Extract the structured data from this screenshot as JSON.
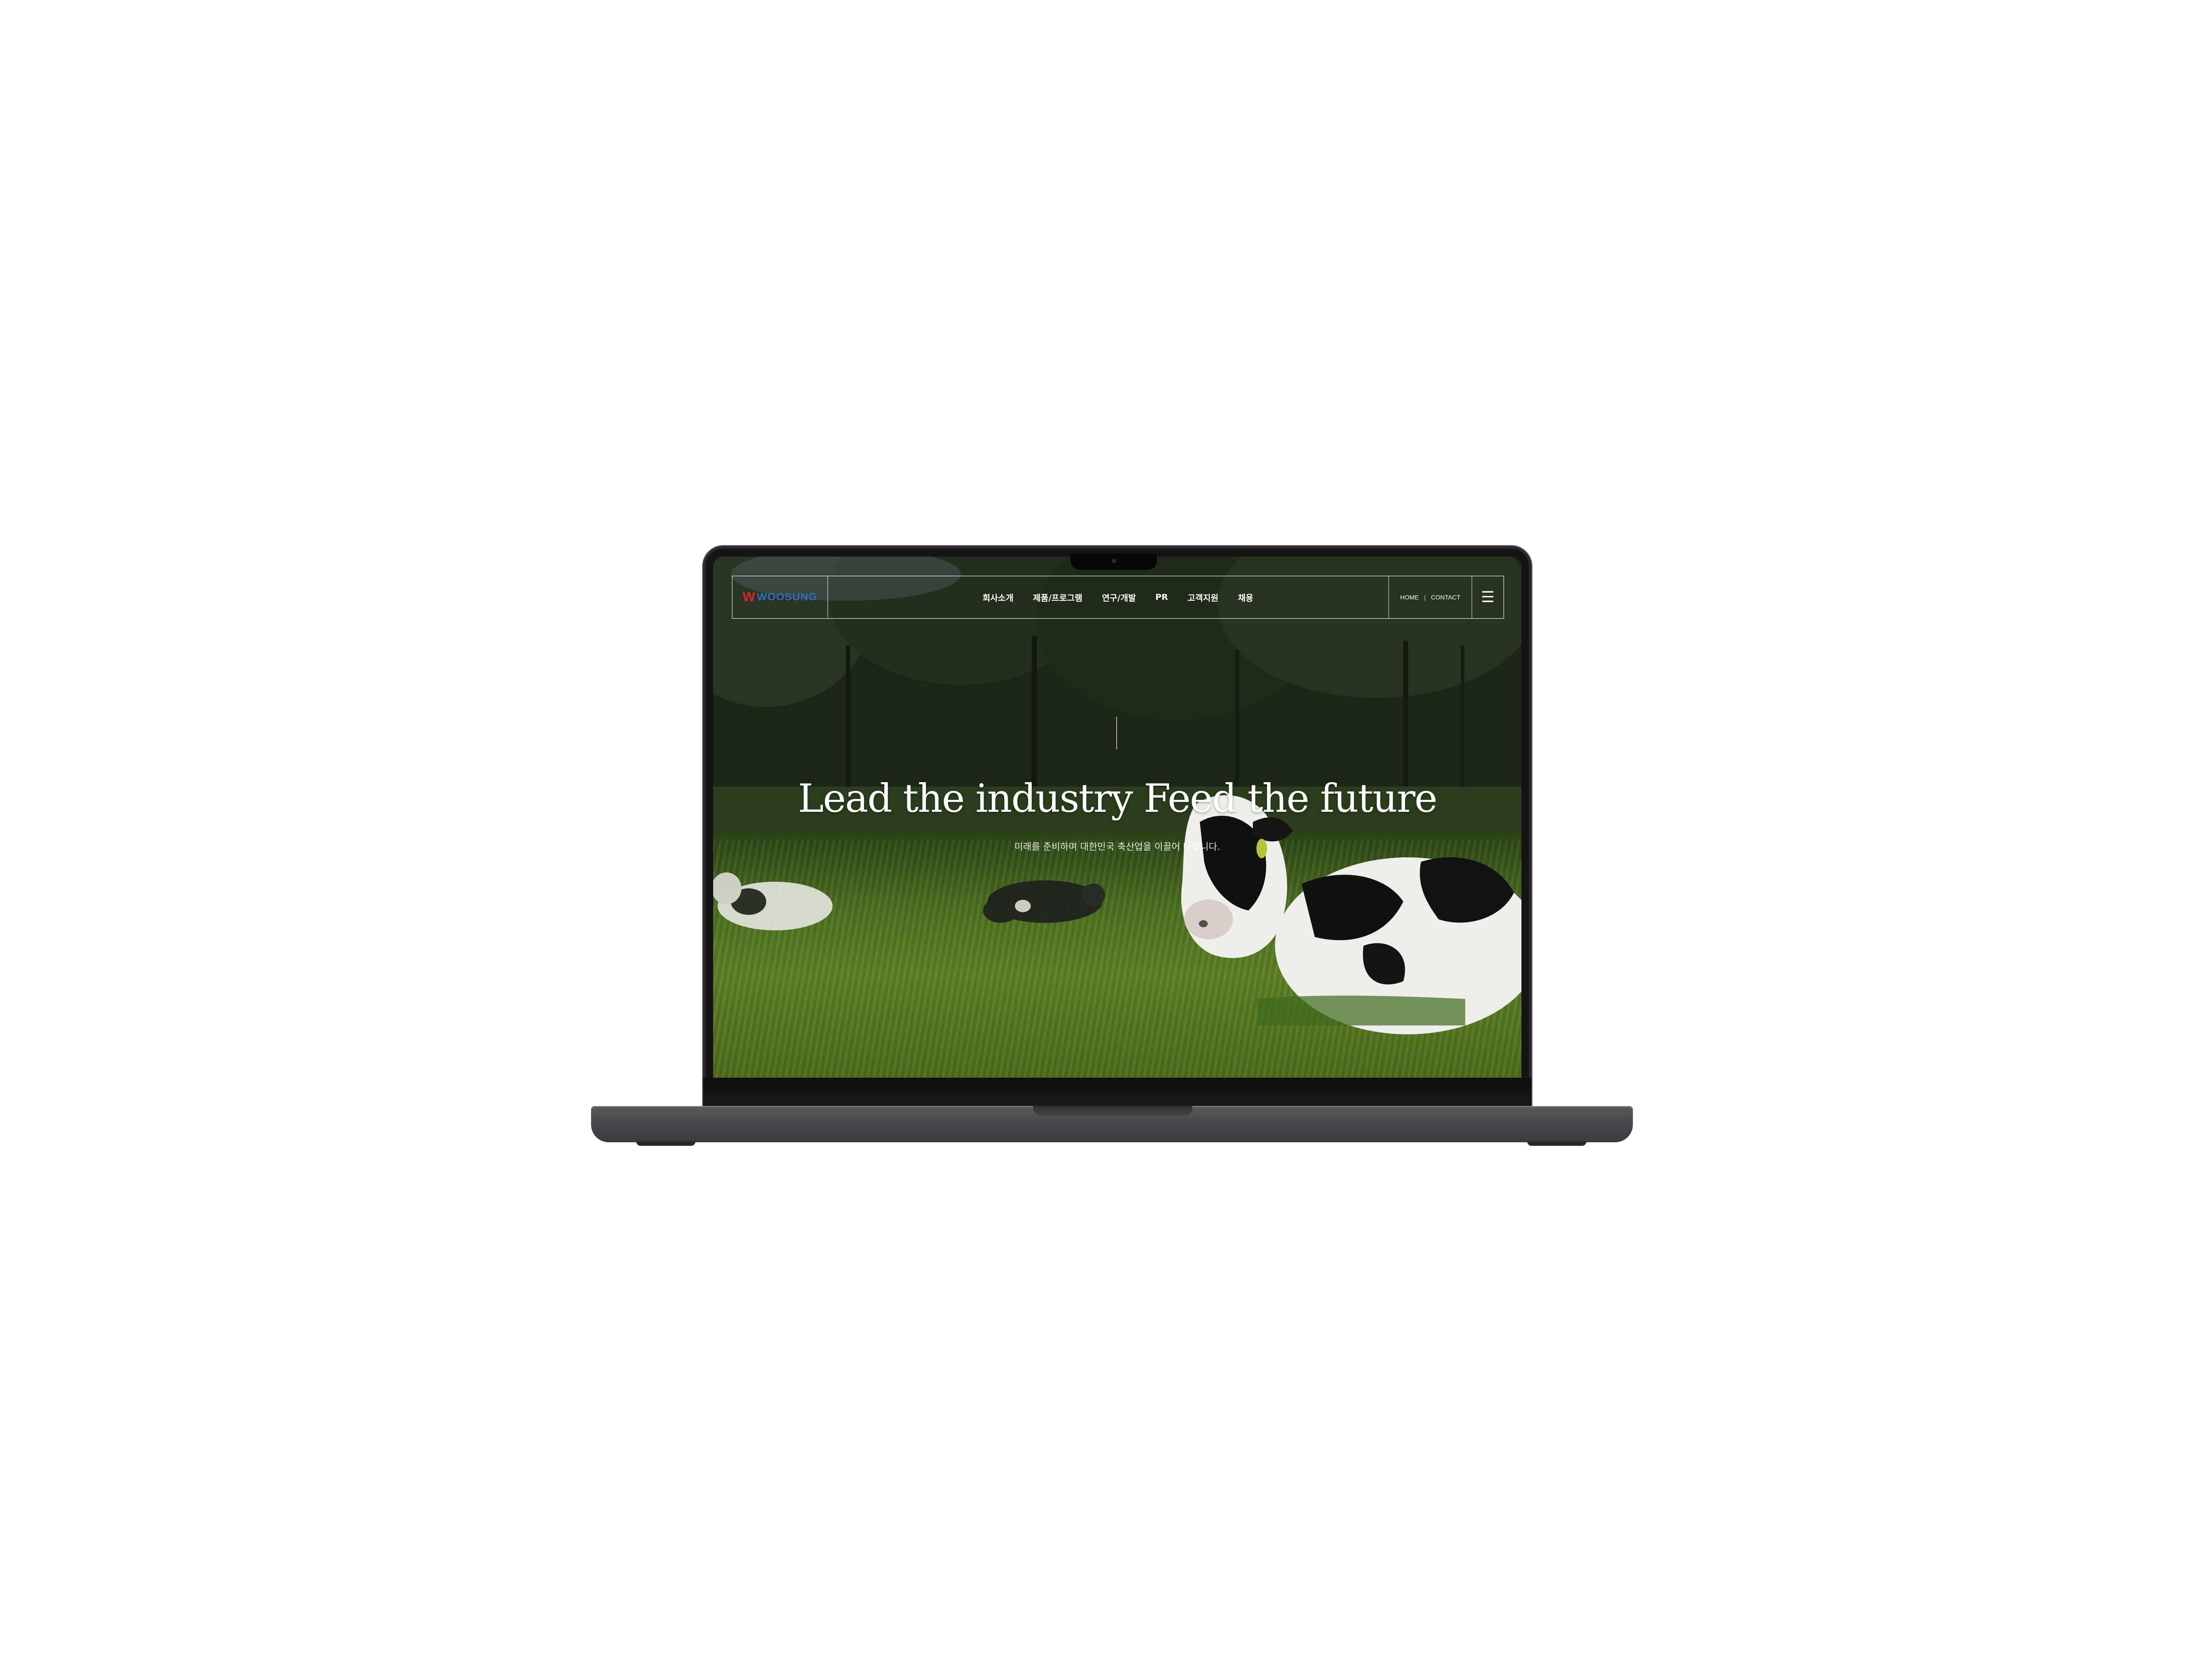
{
  "brand": {
    "logo_mark": "W",
    "logo_text": "WOOSUNG"
  },
  "nav": {
    "items": [
      {
        "label": "회사소개"
      },
      {
        "label": "제품/프로그램"
      },
      {
        "label": "연구/개발"
      },
      {
        "label": "PR"
      },
      {
        "label": "고객지원"
      },
      {
        "label": "채용"
      }
    ]
  },
  "utility": {
    "home": "HOME",
    "separator": "|",
    "contact": "CONTACT",
    "menu_icon": "hamburger-menu-icon"
  },
  "hero": {
    "title": "Lead the industry Feed the future",
    "subtitle": "미래를 준비하며 대한민국 축산업을 이끌어 나갑니다."
  },
  "colors": {
    "logo_red": "#d8262d",
    "logo_blue": "#2c6fc2",
    "text": "#ffffff"
  }
}
